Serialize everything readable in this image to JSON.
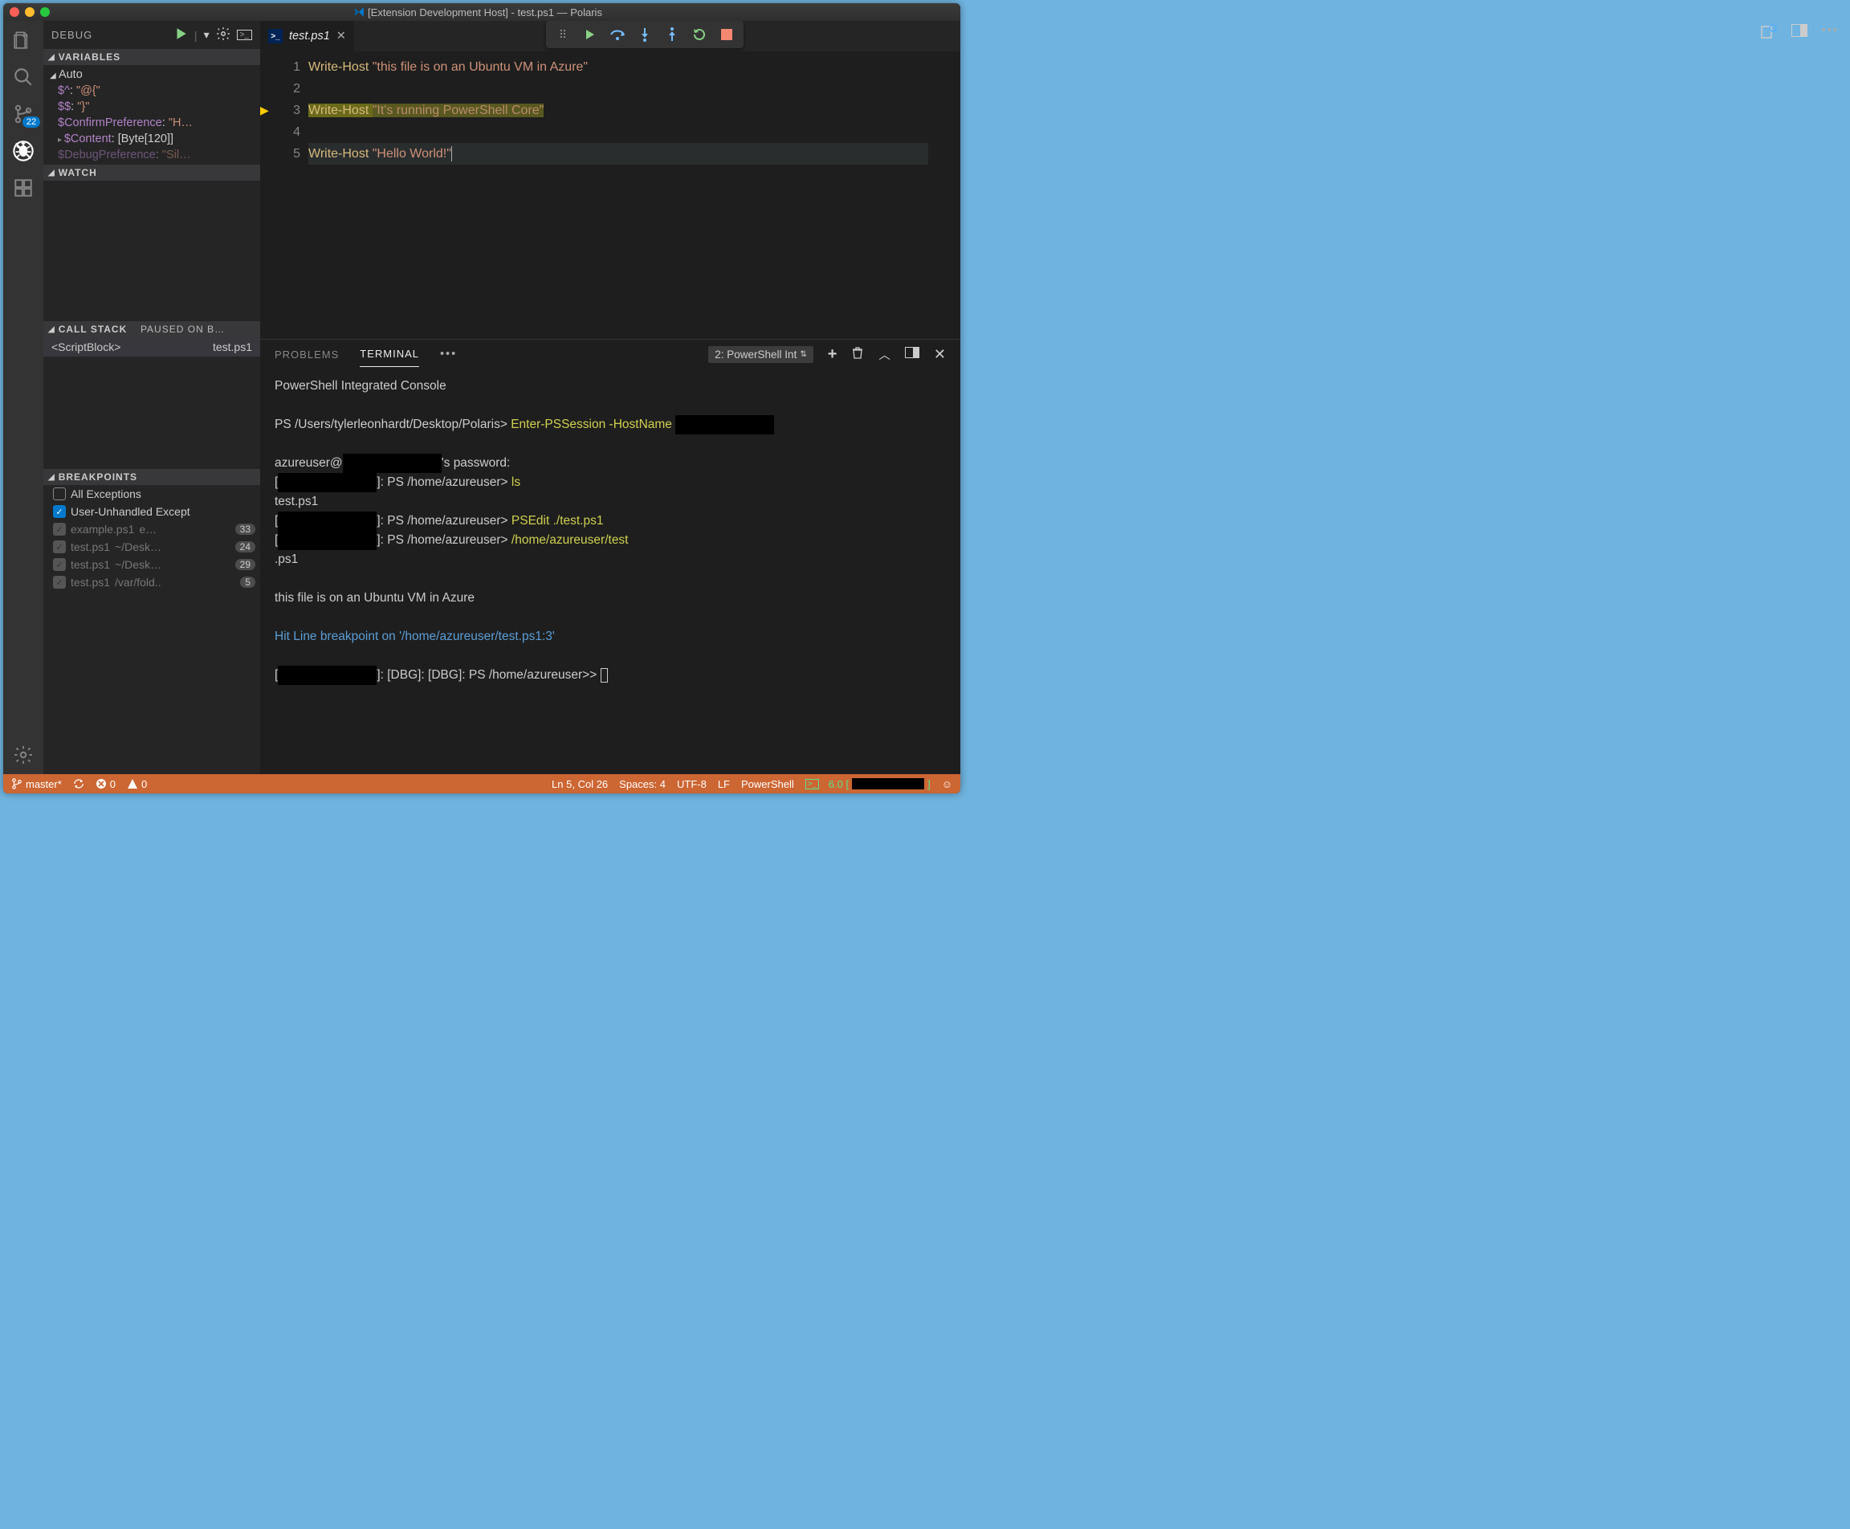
{
  "window_title": "[Extension Development Host] - test.ps1 — Polaris",
  "activity_badge": "22",
  "debug_header": "DEBUG",
  "sections": {
    "variables": "VARIABLES",
    "auto": "Auto",
    "watch": "WATCH",
    "callstack": "CALL STACK",
    "callstack_status": "PAUSED ON B…",
    "breakpoints": "BREAKPOINTS"
  },
  "variables": [
    {
      "name": "$^",
      "value": "\"@{\""
    },
    {
      "name": "$$",
      "value": "\"}\""
    },
    {
      "name": "$ConfirmPreference",
      "value": "\"H…"
    },
    {
      "name": "$Content",
      "value": "[Byte[120]]",
      "expandable": true,
      "is_array": true
    },
    {
      "name": "$DebugPreference",
      "value": "\"Sil…",
      "faded": true
    }
  ],
  "callstack": {
    "name": "<ScriptBlock>",
    "file": "test.ps1"
  },
  "breakpoints": [
    {
      "checked": false,
      "label": "All Exceptions"
    },
    {
      "checked": true,
      "label": "User-Unhandled Except"
    },
    {
      "checked": true,
      "disabled": true,
      "label": "example.ps1",
      "path": "e…",
      "line": "33"
    },
    {
      "checked": true,
      "disabled": true,
      "label": "test.ps1",
      "path": "~/Desk…",
      "line": "24"
    },
    {
      "checked": true,
      "disabled": true,
      "label": "test.ps1",
      "path": "~/Desk…",
      "line": "29"
    },
    {
      "checked": true,
      "disabled": true,
      "label": "test.ps1",
      "path": "/var/fold..",
      "line": "5"
    }
  ],
  "tab": {
    "name": "test.ps1"
  },
  "code_lines": [
    {
      "n": "1",
      "html": [
        {
          "t": "kw",
          "v": "Write-Host "
        },
        {
          "t": "str",
          "v": "\"this file is on an Ubuntu VM in Azure\""
        }
      ]
    },
    {
      "n": "2",
      "html": []
    },
    {
      "n": "3",
      "exec": true,
      "hl": true,
      "html": [
        {
          "t": "kw",
          "v": "Write-Host "
        },
        {
          "t": "hlstr",
          "v": "\"It's running PowerShell Core\""
        }
      ]
    },
    {
      "n": "4",
      "html": []
    },
    {
      "n": "5",
      "current": true,
      "html": [
        {
          "t": "kw",
          "v": "Write-Host "
        },
        {
          "t": "str",
          "v": "\"Hello World!\""
        }
      ],
      "cursor": true
    }
  ],
  "panel_tabs": {
    "problems": "PROBLEMS",
    "terminal": "TERMINAL"
  },
  "terminal_picker": "2: PowerShell Int",
  "terminal_lines": [
    {
      "type": "plain",
      "text": "PowerShell Integrated Console"
    },
    {
      "type": "blank"
    },
    {
      "type": "promptcmd",
      "prefix": "PS /Users/tylerleonhardt/Desktop/Polaris> ",
      "cmd": "Enter-PSSession -HostName ",
      "redact_after": 123
    },
    {
      "type": "blank"
    },
    {
      "type": "pw",
      "before": "azureuser@",
      "after": "'s password:",
      "redact": 123
    },
    {
      "type": "host",
      "prompt": "]: PS /home/azureuser> ",
      "cmd": "ls"
    },
    {
      "type": "plain",
      "text": "test.ps1"
    },
    {
      "type": "host",
      "prompt": "]: PS /home/azureuser> ",
      "cmd": "PSEdit ./test.ps1"
    },
    {
      "type": "host",
      "prompt": "]: PS /home/azureuser> ",
      "cmd": "/home/azureuser/test"
    },
    {
      "type": "plain",
      "text": ".ps1"
    },
    {
      "type": "blank"
    },
    {
      "type": "plain",
      "text": "this file is on an Ubuntu VM in Azure"
    },
    {
      "type": "blank"
    },
    {
      "type": "blue",
      "text": "Hit Line breakpoint on '/home/azureuser/test.ps1:3'"
    },
    {
      "type": "blank"
    },
    {
      "type": "dbg",
      "prompt": "]: [DBG]: [DBG]: PS /home/azureuser>> "
    }
  ],
  "status": {
    "branch": "master*",
    "errors": "0",
    "warnings": "0",
    "ln_col": "Ln 5, Col 26",
    "spaces": "Spaces: 4",
    "encoding": "UTF-8",
    "eol": "LF",
    "language": "PowerShell",
    "psver_prefix": "6.0 [",
    "psver_suffix": "]"
  }
}
